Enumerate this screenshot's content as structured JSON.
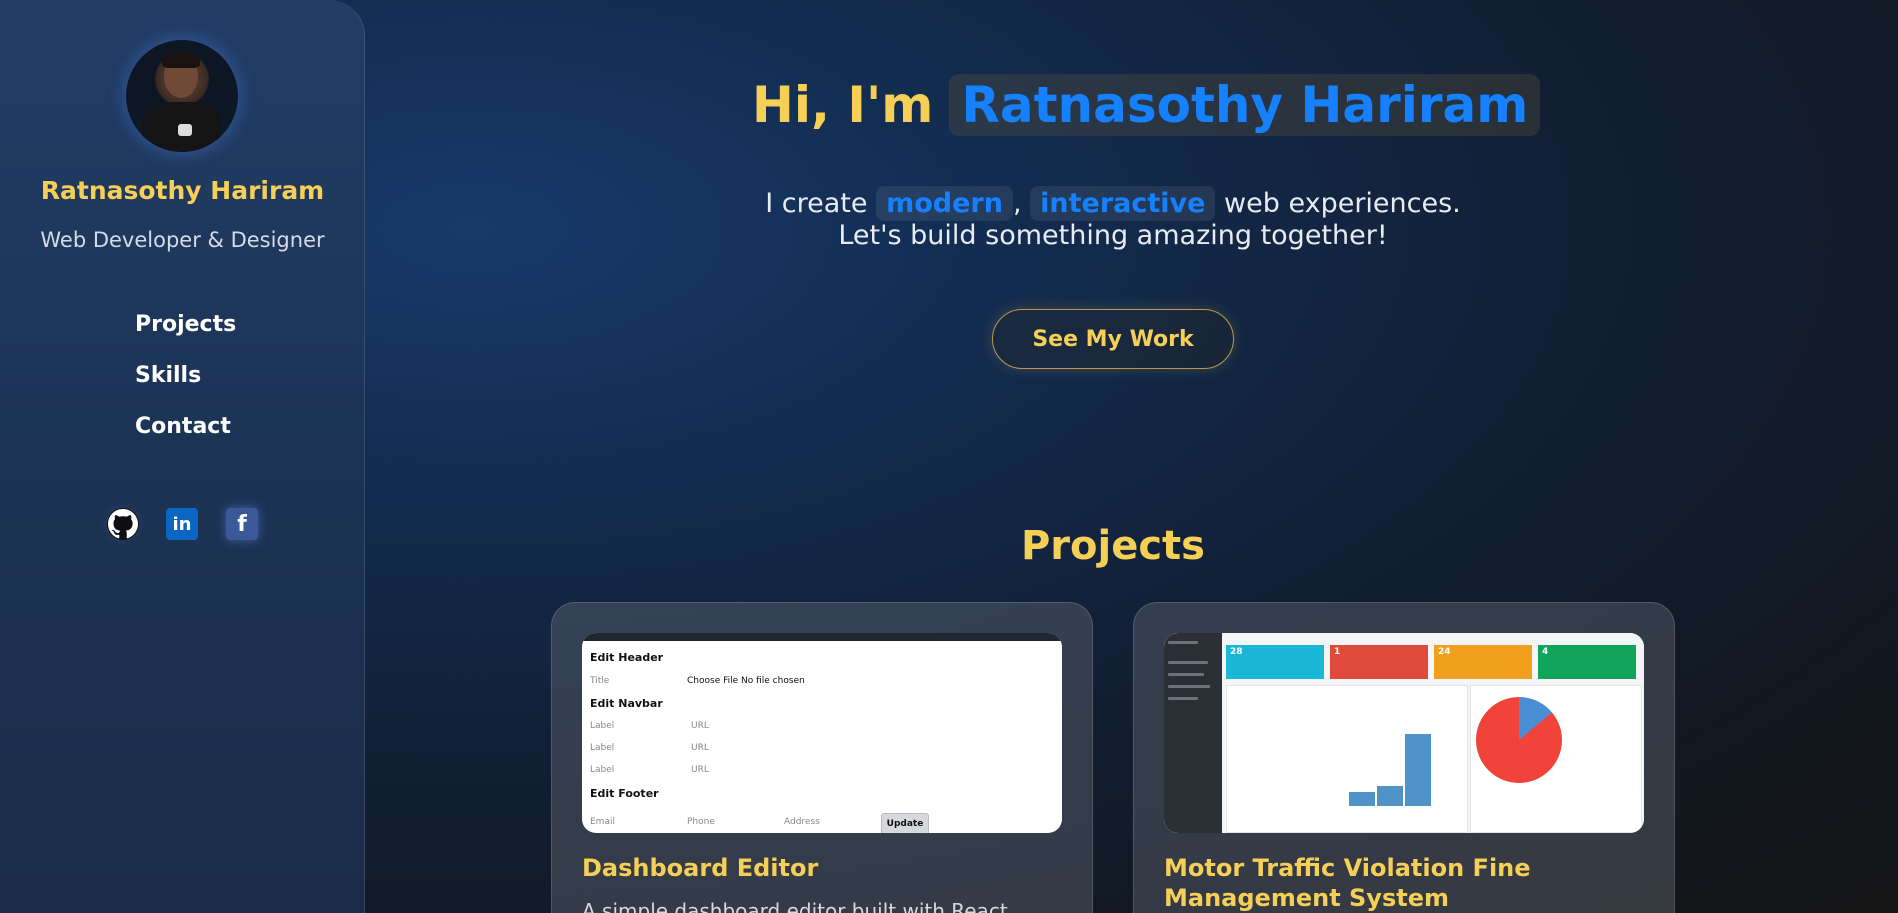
{
  "sidebar": {
    "name": "Ratnasothy Hariram",
    "role": "Web Developer & Designer",
    "nav": [
      {
        "label": "Projects"
      },
      {
        "label": "Skills"
      },
      {
        "label": "Contact"
      }
    ],
    "social": {
      "linkedin_glyph": "in",
      "facebook_glyph": "f"
    }
  },
  "hero": {
    "greeting": "Hi, I'm",
    "name": "Ratnasothy Hariram",
    "line1_before": "I create",
    "word1": "modern",
    "comma": ",",
    "word2": "interactive",
    "line1_after": "web experiences.",
    "line2": "Let's build something amazing together!",
    "cta": "See My Work"
  },
  "projects": {
    "title": "Projects",
    "cards": [
      {
        "title": "Dashboard Editor",
        "description": "A simple dashboard editor built with React"
      },
      {
        "title": "Motor Traffic Violation Fine Management System",
        "description": ""
      }
    ],
    "editor_thumb": {
      "edit_header": "Edit Header",
      "title_label": "Title",
      "file_text": "Choose File  No file chosen",
      "edit_navbar": "Edit Navbar",
      "label": "Label",
      "url": "URL",
      "edit_footer": "Edit Footer",
      "email": "Email",
      "phone": "Phone",
      "address": "Address",
      "update": "Update"
    },
    "traffic_thumb": {
      "tiles": [
        "28",
        "1",
        "24",
        "4"
      ],
      "tile_colors": [
        "#1bb7d6",
        "#e04a3a",
        "#f0a01c",
        "#12a55a"
      ]
    }
  },
  "colors": {
    "accent_yellow": "#f6cf57",
    "accent_blue": "#1681ff"
  }
}
